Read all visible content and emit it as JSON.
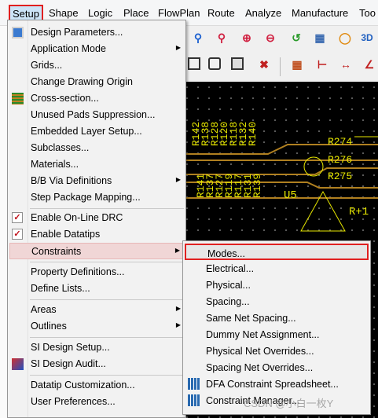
{
  "menubar": {
    "items": [
      "Setup",
      "Shape",
      "Logic",
      "Place",
      "FlowPlan",
      "Route",
      "Analyze",
      "Manufacture",
      "Too"
    ]
  },
  "canvas": {
    "refdes": [
      "R142",
      "R141",
      "R138",
      "R137",
      "R128",
      "R127",
      "R120",
      "R119",
      "R118",
      "R117",
      "R132",
      "R131",
      "R140",
      "R139",
      "R274",
      "R276",
      "R275",
      "U5",
      "R+1"
    ]
  },
  "setup_menu": {
    "items": [
      {
        "label": "Design Parameters...",
        "submenu": false
      },
      {
        "label": "Application Mode",
        "submenu": true
      },
      {
        "label": "Grids...",
        "submenu": false
      },
      {
        "label": "Change Drawing Origin",
        "submenu": false
      },
      {
        "label": "Cross-section...",
        "submenu": false
      },
      {
        "label": "Unused Pads Suppression...",
        "submenu": false
      },
      {
        "label": "Embedded Layer Setup...",
        "submenu": false
      },
      {
        "label": "Subclasses...",
        "submenu": false
      },
      {
        "label": "Materials...",
        "submenu": false
      },
      {
        "label": "B/B Via Definitions",
        "submenu": true
      },
      {
        "label": "Step Package Mapping...",
        "submenu": false
      },
      {
        "label": "Enable On-Line DRC",
        "checked": true
      },
      {
        "label": "Enable Datatips",
        "checked": true
      },
      {
        "label": "Constraints",
        "submenu": true,
        "highlighted": true
      },
      {
        "label": "Property Definitions...",
        "submenu": false
      },
      {
        "label": "Define Lists...",
        "submenu": false
      },
      {
        "label": "Areas",
        "submenu": true
      },
      {
        "label": "Outlines",
        "submenu": true
      },
      {
        "label": "SI Design Setup...",
        "submenu": false
      },
      {
        "label": "SI Design Audit...",
        "submenu": false
      },
      {
        "label": "Datatip Customization...",
        "submenu": false
      },
      {
        "label": "User Preferences...",
        "submenu": false
      }
    ]
  },
  "constraints_submenu": {
    "items": [
      {
        "label": "Modes...",
        "highlighted": true
      },
      {
        "label": "Electrical..."
      },
      {
        "label": "Physical..."
      },
      {
        "label": "Spacing..."
      },
      {
        "label": "Same Net Spacing..."
      },
      {
        "label": "Dummy Net Assignment..."
      },
      {
        "label": "Physical Net Overrides..."
      },
      {
        "label": "Spacing Net Overrides..."
      },
      {
        "label": "DFA Constraint Spreadsheet..."
      },
      {
        "label": "Constraint Manager..."
      }
    ]
  },
  "watermark": "CSDN @小白一枚Y",
  "colors": {
    "highlight_border": "#e02020",
    "pcb_yellow": "#e8e800",
    "pcb_bg": "#000000"
  }
}
